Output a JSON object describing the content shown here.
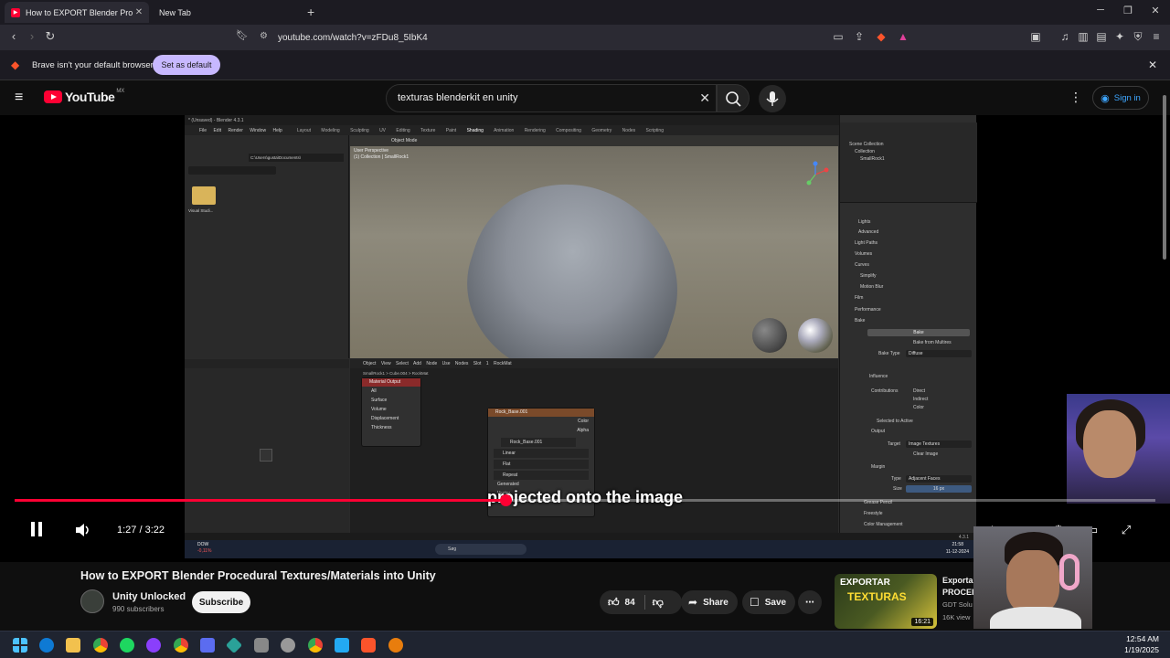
{
  "browser": {
    "tabs": [
      {
        "title": "How to EXPORT Blender Proc",
        "active": true
      },
      {
        "title": "New Tab",
        "active": false
      }
    ],
    "url": "youtube.com/watch?v=zFDu8_5IbK4",
    "notice": {
      "text": "Brave isn't your default browser",
      "button": "Set as default"
    }
  },
  "youtube": {
    "logo": "YouTube",
    "region": "MX",
    "search_query": "texturas blenderkit en unity",
    "sign_in": "Sign in"
  },
  "player": {
    "caption": "projected onto the image",
    "time": "1:27 / 3:22",
    "progress": 0.43,
    "blender": {
      "title": "* (Unsaved) - Blender 4.3.1",
      "menu": [
        "File",
        "Edit",
        "Render",
        "Window",
        "Help"
      ],
      "workspaces": [
        "Layout",
        "Modeling",
        "Sculpting",
        "UV Editing",
        "Texture Paint",
        "Shading",
        "Animation",
        "Rendering",
        "Compositing",
        "Geometry Nodes",
        "Scripting"
      ],
      "file_path": "C:\\Users\\gusta\\Documents\\",
      "folder_label": "Visual Studi...",
      "viewport_header": "Object Mode",
      "viewport_info1": "User Perspective",
      "viewport_info2": "(1) Collection | SmallRock1",
      "outliner": [
        "Scene Collection",
        "Collection",
        "SmallRock1"
      ],
      "props": [
        "Lights",
        "Advanced",
        "Light Paths",
        "Volumes",
        "Curves",
        "Simplify",
        "Motion Blur",
        "Film",
        "Performance",
        "Bake"
      ],
      "bake_button": "Bake",
      "bake_multires": "Bake from Multires",
      "bake_type_label": "Bake Type",
      "bake_type": "Diffuse",
      "influence": "Influence",
      "contributions": "Contributions",
      "direct": "Direct",
      "indirect": "Indirect",
      "color": "Color",
      "selected_to_active": "Selected to Active",
      "output": "Output",
      "target_label": "Target",
      "target": "Image Textures",
      "clear_image": "Clear Image",
      "margin": "Margin",
      "margin_type_label": "Type",
      "margin_type": "Adjacent Faces",
      "margin_size_label": "Size",
      "margin_size": "16 px",
      "extra": [
        "Grease Pencil",
        "Freestyle",
        "Color Management"
      ],
      "node_header": [
        "Object",
        "View",
        "Select",
        "Add",
        "Node",
        "Use Nodes",
        "Slot 1",
        "RockMat"
      ],
      "node_breadcrumb": "SmallRock1 > Cube.004 > RockMat",
      "node_output": {
        "title": "Material Output",
        "option": "All",
        "rows": [
          "Surface",
          "Volume",
          "Displacement",
          "Thickness"
        ]
      },
      "node_image": {
        "title": "Rock_Base.001",
        "outputs": [
          "Color",
          "Alpha"
        ],
        "image": "Rock_Base.001",
        "interp": "Linear",
        "proj": "Flat",
        "ext": "Repeat",
        "source": "Generated",
        "vector": "Vector"
      },
      "status_version": "4.3.1"
    },
    "inner_taskbar": {
      "weather": "DOW",
      "weather_sub": "-0,11%",
      "search": "Søg",
      "time": "21:58",
      "date": "11-12-2024"
    }
  },
  "video": {
    "title": "How to EXPORT Blender Procedural Textures/Materials into Unity",
    "channel": "Unity Unlocked",
    "subscribers": "990 subscribers",
    "subscribe": "Subscribe",
    "likes": "84",
    "share": "Share",
    "save": "Save"
  },
  "recommended": {
    "thumb_line1": "EXPORTAR",
    "thumb_line2": "TEXTURAS",
    "duration": "16:21",
    "title1": "Exportar",
    "title2": "PROCEI",
    "channel": "GDT Solu",
    "views": "16K view"
  },
  "taskbar": {
    "time": "12:54 AM",
    "date": "1/19/2025"
  },
  "colors": {
    "accent": "#ff0033",
    "link": "#3ea6ff",
    "set_default": "#c7b8ff"
  }
}
